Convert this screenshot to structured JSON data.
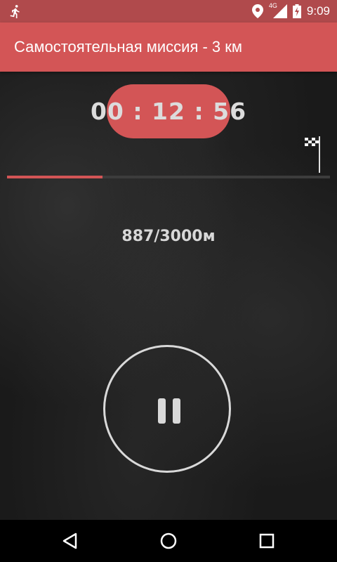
{
  "status_bar": {
    "time": "9:09",
    "network": "4G",
    "icons": [
      "running-man-icon",
      "location-icon",
      "signal-icon",
      "battery-charging-icon"
    ]
  },
  "app_bar": {
    "title": "Самостоятельная миссия - 3 км"
  },
  "timer": {
    "display": "00 : 12 : 56"
  },
  "progress": {
    "current_m": 887,
    "target_m": 3000,
    "label": "887/3000м",
    "finish_icon": "checkered-flag-icon"
  },
  "controls": {
    "pause_icon": "pause-icon"
  },
  "nav_bar": {
    "buttons": [
      "back-icon",
      "home-icon",
      "recents-icon"
    ]
  },
  "colors": {
    "accent": "#d35556",
    "status_bar": "#b04a4c",
    "text_light": "#dcdcdc"
  }
}
